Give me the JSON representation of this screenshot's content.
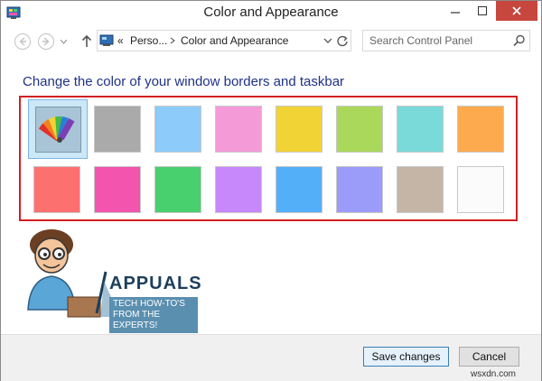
{
  "window": {
    "title": "Color and Appearance",
    "address": {
      "overflow": "«",
      "segments": [
        "Perso...",
        "Color and Appearance"
      ]
    },
    "search": {
      "placeholder": "Search Control Panel"
    }
  },
  "content": {
    "heading": "Change the color of your window borders and taskbar",
    "colors": {
      "row1": [
        "automatic",
        "#aaaaaa",
        "#8dcbfa",
        "#f49bd7",
        "#f2d336",
        "#aad85a",
        "#7ad9d9",
        "#fdaa4e"
      ],
      "row2": [
        "#fd7070",
        "#f354ad",
        "#48cf6e",
        "#c688fb",
        "#54aff9",
        "#9b9cfa",
        "#c4b5a6",
        "#fbfbfb"
      ]
    },
    "selected_index": 0
  },
  "watermark": {
    "brand": "APPUALS",
    "tagline": "TECH HOW-TO'S FROM THE EXPERTS!",
    "site": "wsxdn.com"
  },
  "footer": {
    "save_label": "Save changes",
    "cancel_label": "Cancel"
  },
  "theme": {
    "heading_color": "#1e3287",
    "highlight_border": "#d22023",
    "close_color": "#c7463d"
  }
}
